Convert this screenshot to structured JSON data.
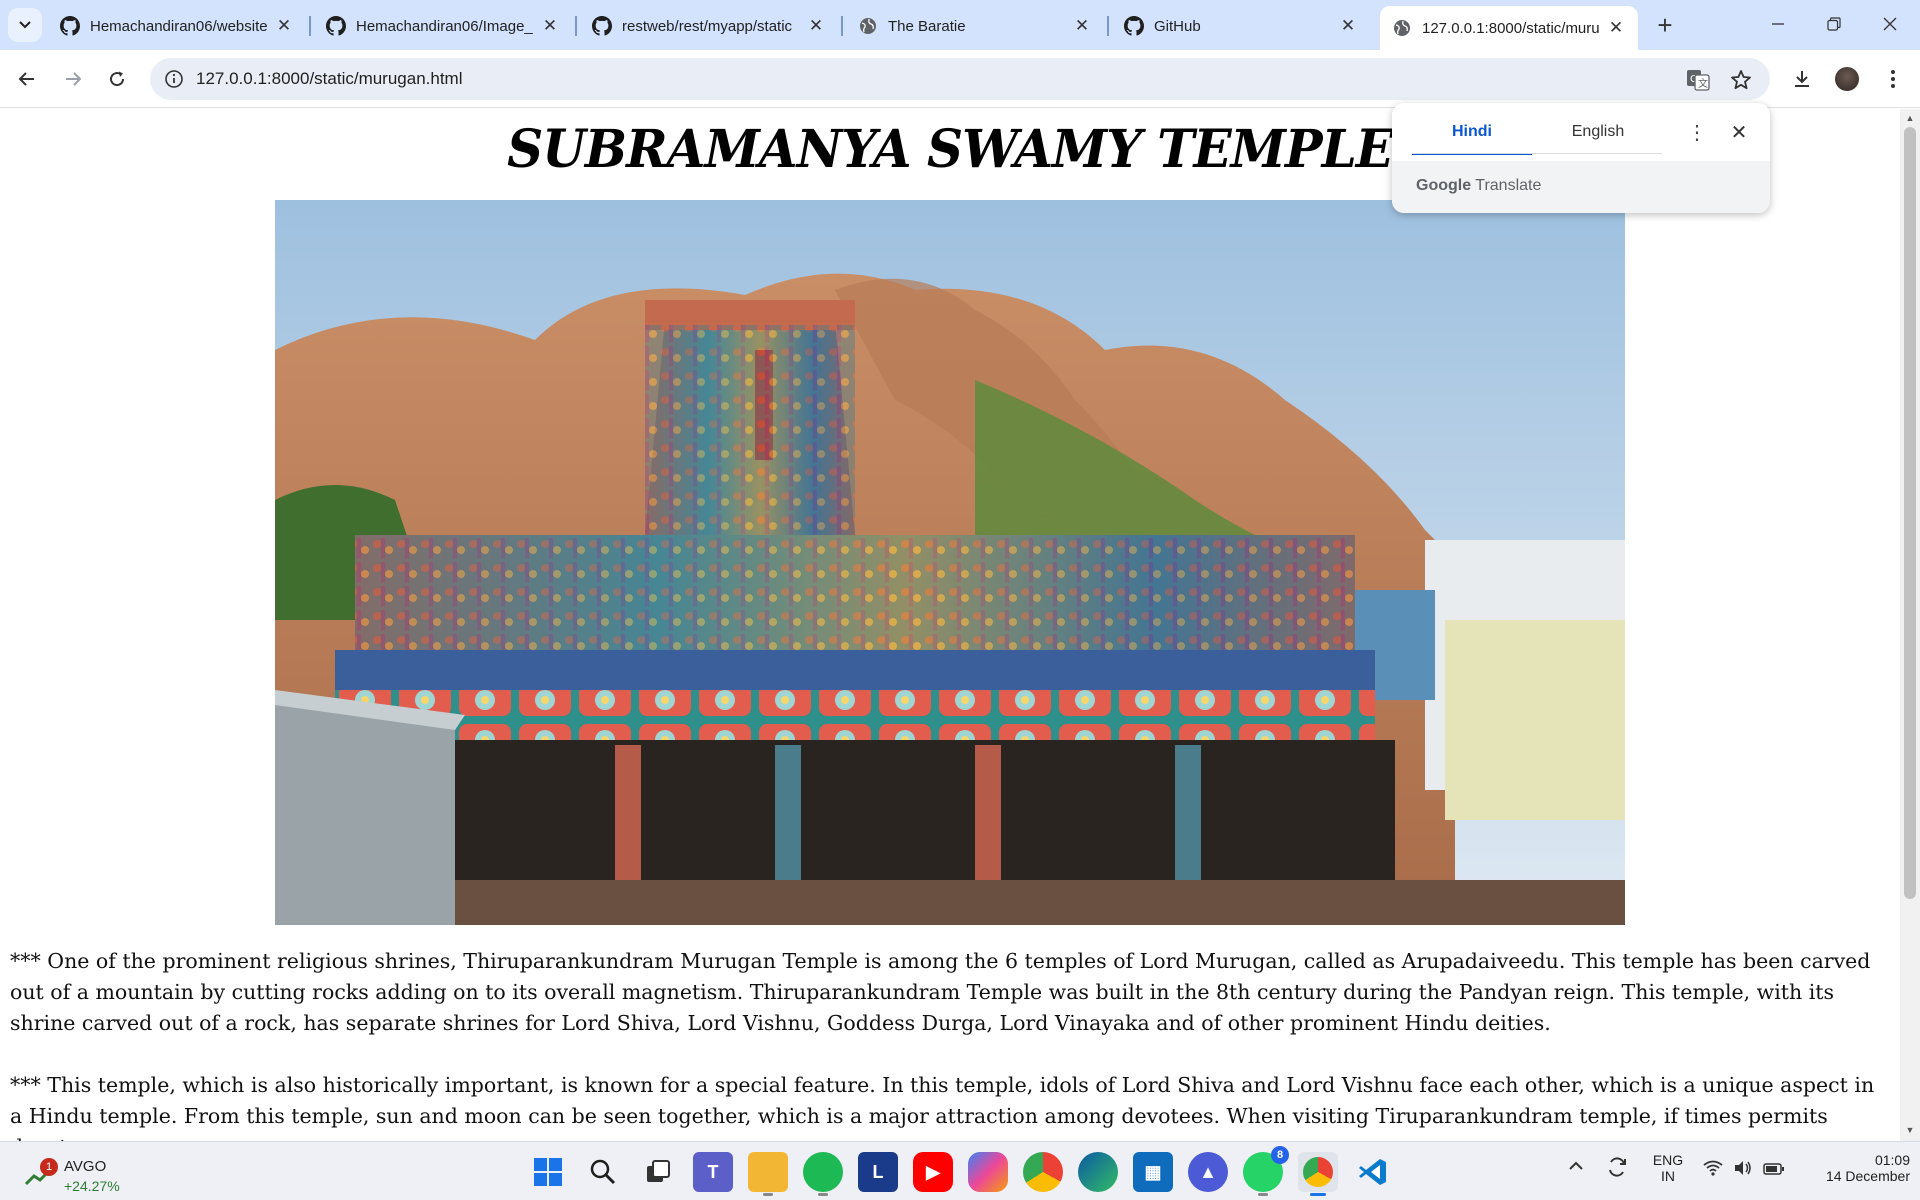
{
  "browser": {
    "tabs": [
      {
        "title": "Hemachandiran06/website",
        "icon": "github-icon"
      },
      {
        "title": "Hemachandiran06/Image_",
        "icon": "github-icon"
      },
      {
        "title": "restweb/rest/myapp/static",
        "icon": "github-icon"
      },
      {
        "title": "The Baratie",
        "icon": "globe-icon"
      },
      {
        "title": "GitHub",
        "icon": "github-icon"
      },
      {
        "title": "127.0.0.1:8000/static/muru",
        "icon": "globe-icon",
        "active": true
      }
    ],
    "url": "127.0.0.1:8000/static/murugan.html"
  },
  "translate_popup": {
    "tab_hindi": "Hindi",
    "tab_english": "English",
    "selected": "Hindi",
    "footer_google": "Google",
    "footer_translate": "Translate"
  },
  "page": {
    "title": "SUBRAMANYA SWAMY TEMPLE",
    "image_alt": "Thiruparankundram Murugan Temple",
    "paragraphs": [
      "*** One of the prominent religious shrines, Thiruparankundram Murugan Temple is among the 6 temples of Lord Murugan, called as Arupadaiveedu. This temple has been carved out of a mountain by cutting rocks adding on to its overall magnetism. Thiruparankundram Temple was built in the 8th century during the Pandyan reign. This temple, with its shrine carved out of a rock, has separate shrines for Lord Shiva, Lord Vishnu, Goddess Durga, Lord Vinayaka and of other prominent Hindu deities.",
      "*** This temple, which is also historically important, is known for a special feature. In this temple, idols of Lord Shiva and Lord Vishnu face each other, which is a unique aspect in a Hindu temple. From this temple, sun and moon can be seen together, which is a major attraction among devotees. When visiting Tiruparankundram temple, if times permits devotees"
    ]
  },
  "taskbar": {
    "widget": {
      "badge": "1",
      "symbol": "AVGO",
      "change": "+24.27%"
    },
    "apps": [
      "windows-start-icon",
      "search-icon",
      "task-view-icon",
      "teams-icon",
      "file-explorer-icon",
      "spotify-icon",
      "l-app-icon",
      "youtube-icon",
      "copilot-icon",
      "chrome-icon",
      "edge-icon",
      "store-icon",
      "proton-icon",
      "whatsapp-icon",
      "chrome-profile-icon",
      "vscode-icon"
    ],
    "whatsapp_badge": "8",
    "lang_top": "ENG",
    "lang_bottom": "IN",
    "time": "01:09",
    "date": "14 December"
  },
  "colors": {
    "tabstrip": "#d3e3fd",
    "accent": "#0b57d0",
    "stock_up": "#2e7d32"
  }
}
